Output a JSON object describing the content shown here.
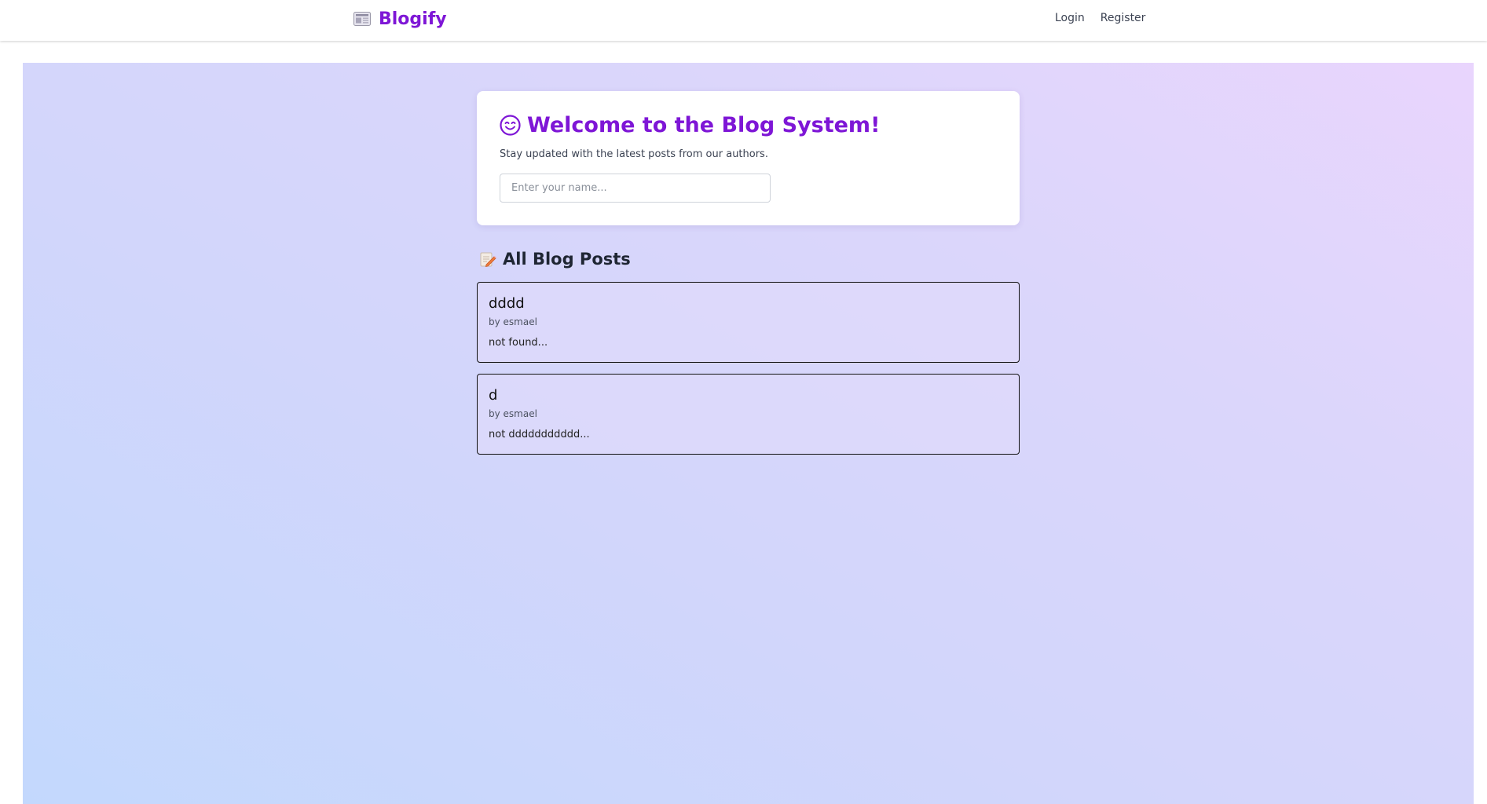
{
  "navbar": {
    "brand_icon": "newspaper-icon",
    "brand_name": "Blogify",
    "links": [
      {
        "label": "Login"
      },
      {
        "label": "Register"
      }
    ]
  },
  "welcome": {
    "icon": "smiling-face-icon",
    "title": "Welcome to the Blog System!",
    "subtitle": "Stay updated with the latest posts from our authors.",
    "name_input": {
      "placeholder": "Enter your name...",
      "value": ""
    }
  },
  "posts_section": {
    "icon": "memo-icon",
    "heading": "All Blog Posts",
    "posts": [
      {
        "title": "dddd",
        "author": "by esmael",
        "excerpt": "not found..."
      },
      {
        "title": "d",
        "author": "by esmael",
        "excerpt": "not ddddddddddd..."
      }
    ]
  },
  "colors": {
    "brand": "#7e16d6",
    "heading_dark": "#1f2633",
    "background_gradient_start": "#c3d8fd",
    "background_gradient_end": "#e9d5fd"
  }
}
